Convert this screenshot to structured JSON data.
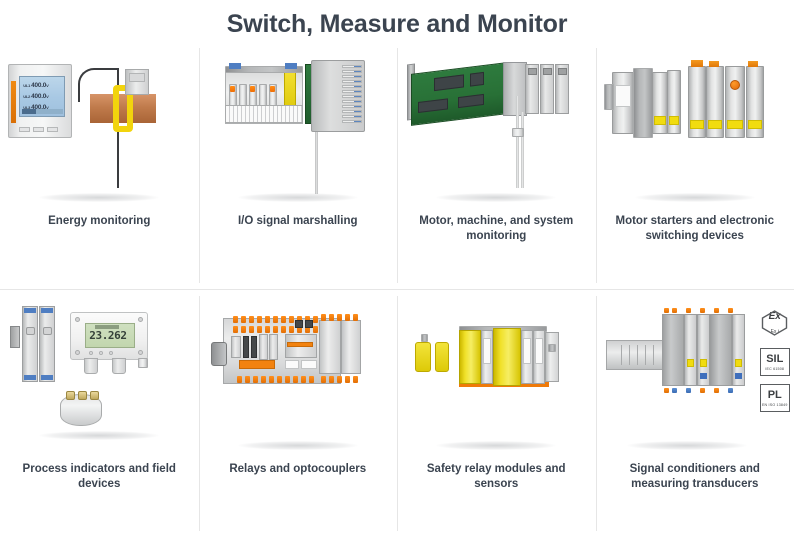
{
  "header": {
    "title": "Switch, Measure and Monitor"
  },
  "grid": {
    "rows": [
      {
        "cells": [
          {
            "caption": "Energy monitoring",
            "art": "energy-meter-with-current-transformer",
            "display": {
              "lines": [
                "400.0",
                "400.0",
                "400.0"
              ],
              "unit": "V",
              "labels": [
                "UL1",
                "UL2",
                "UL3"
              ]
            }
          },
          {
            "caption": "I/O signal marshalling",
            "art": "io-marshalling-terminal-blocks"
          },
          {
            "caption": "Motor, machine, and system monitoring",
            "art": "pcb-board-with-din-rail-modules"
          },
          {
            "caption": "Motor starters and electronic switching devices",
            "art": "din-rail-motor-starter-modules"
          }
        ]
      },
      {
        "cells": [
          {
            "caption": "Process indicators and field devices",
            "art": "field-indicator-and-head-transmitter",
            "display": {
              "value": "23.262"
            }
          },
          {
            "caption": "Relays and optocouplers",
            "art": "relay-and-optocoupler-modules"
          },
          {
            "caption": "Safety relay modules and sensors",
            "art": "yellow-safety-relay-modules"
          },
          {
            "caption": "Signal conditioners and measuring transducers",
            "art": "signal-conditioner-modules",
            "badges": [
              {
                "main": "Ex",
                "sub": "Ex i",
                "shape": "hexagon"
              },
              {
                "main": "SIL",
                "sub": "IEC 61508",
                "shape": "box"
              },
              {
                "main": "PL",
                "sub": "EN ISO 13849",
                "shape": "box"
              }
            ]
          }
        ]
      }
    ]
  },
  "colors": {
    "text": "#3b4450",
    "divider": "#e6e6e6",
    "background": "#ffffff",
    "orange": "#ef7a09",
    "yellow": "#f2dd13",
    "green_pcb": "#2e7b3e",
    "copper": "#c07b4c"
  }
}
